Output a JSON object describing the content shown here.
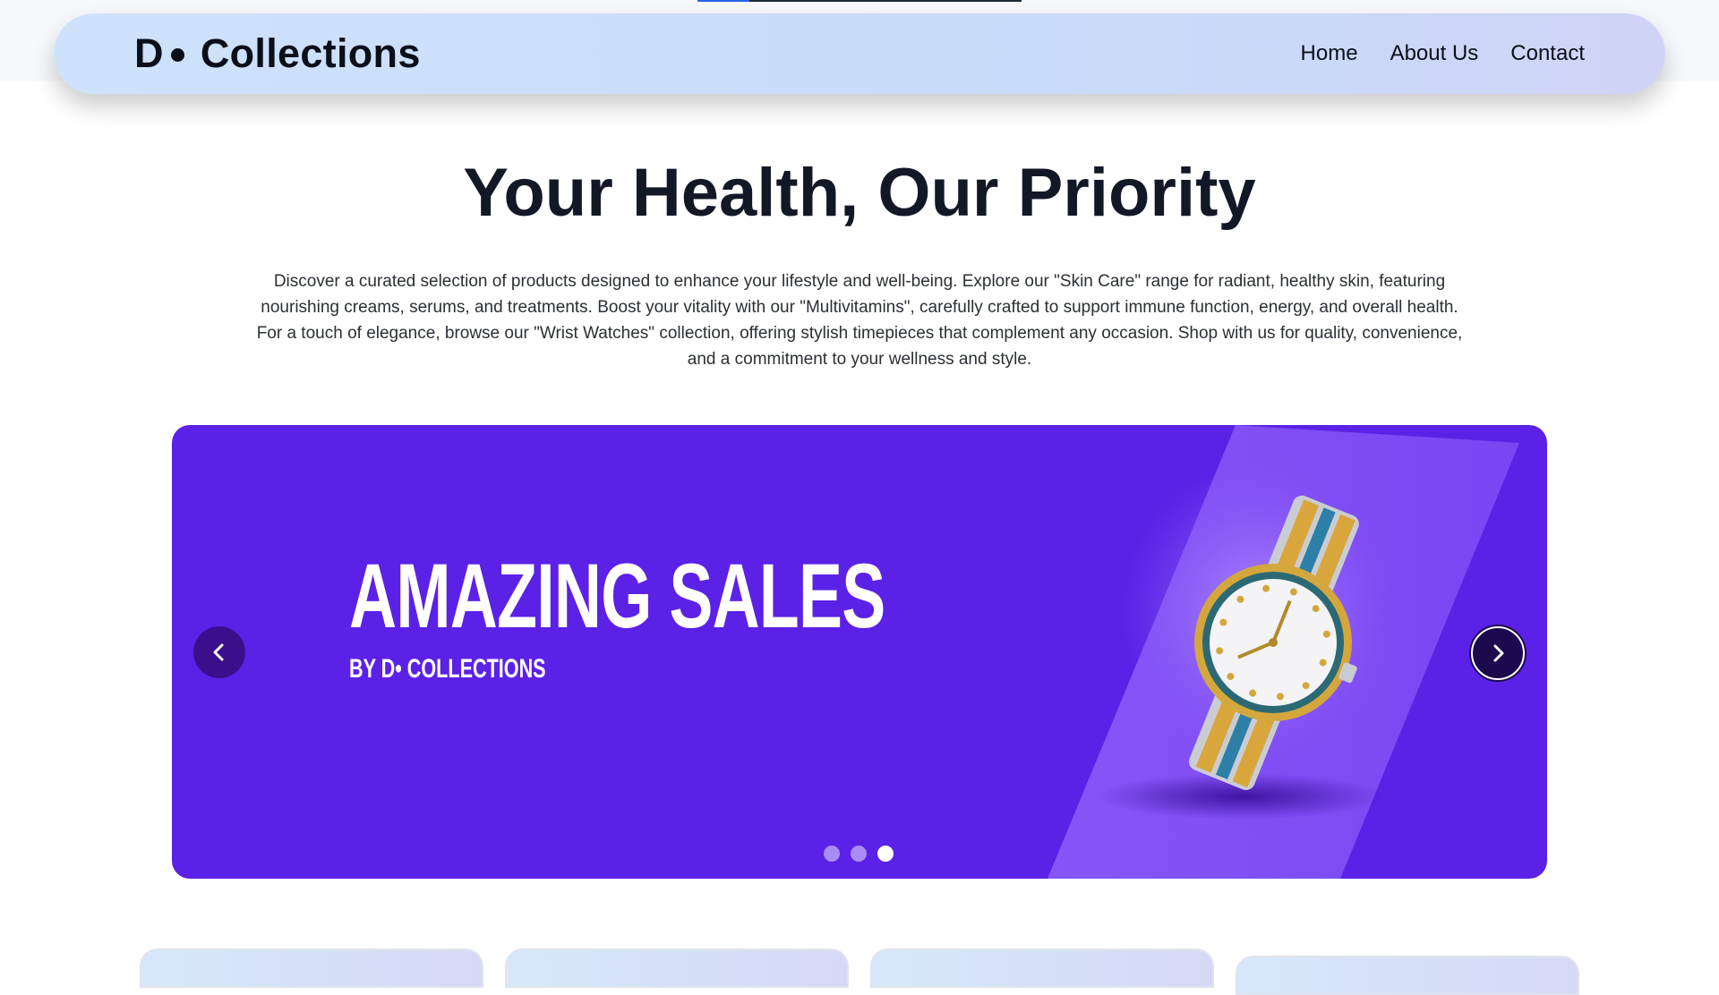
{
  "brand": {
    "name": "Collections",
    "letter": "D"
  },
  "nav": {
    "items": [
      "Home",
      "About Us",
      "Contact"
    ]
  },
  "hero": {
    "title": "Your Health, Our Priority",
    "description": "Discover a curated selection of products designed to enhance your lifestyle and well-being. Explore our \"Skin Care\" range for radiant, healthy skin, featuring nourishing creams, serums, and treatments. Boost your vitality with our \"Multivitamins\", carefully crafted to support immune function, energy, and overall health. For a touch of elegance, browse our \"Wrist Watches\" collection, offering stylish timepieces that complement any occasion. Shop with us for quality, convenience, and a commitment to your wellness and style."
  },
  "carousel": {
    "slide_title": "AMAZING SALES",
    "slide_subtitle": "BY D• COLLECTIONS",
    "slide_count": 3,
    "active_index": 2,
    "colors": {
      "background": "#5b21e6",
      "band": "#8a5cf7"
    }
  },
  "page_loading_progress": 0.16,
  "icons": [
    "chevron-left-icon",
    "chevron-right-icon",
    "watch-image"
  ]
}
